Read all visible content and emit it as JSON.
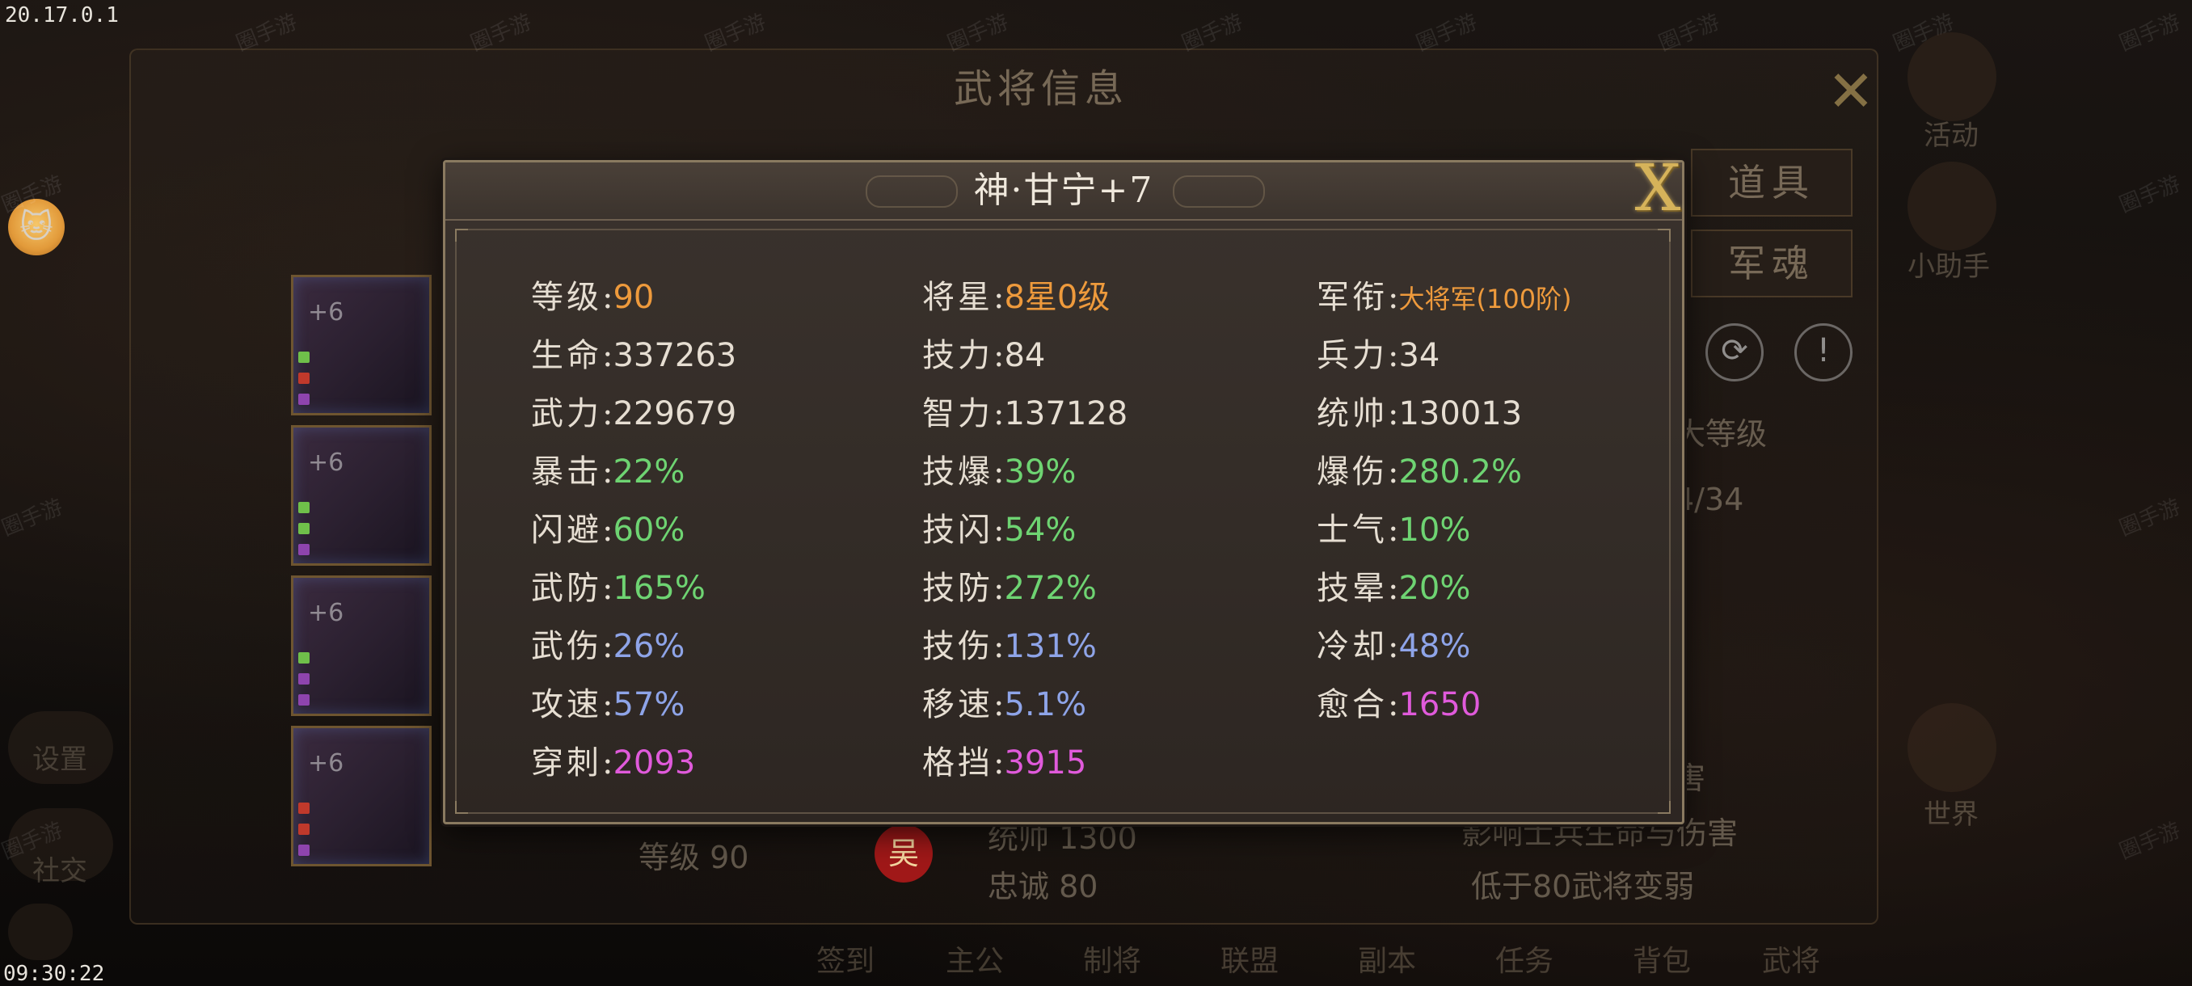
{
  "status": {
    "version": "20.17.0.1",
    "clock": "09:30:22"
  },
  "background_panel": {
    "title": "武将信息",
    "tabs": [
      "道具",
      "军魂"
    ],
    "equipment_levels": [
      "+6",
      "+6",
      "+6",
      "+6"
    ],
    "hero_level_text": "等级 90",
    "faction_badge": "吴",
    "command_text": "统帅 1300",
    "loyalty_text": "忠诚 80",
    "rank_text": "大等级",
    "ratio_text": "4/34",
    "effect_line_1": "害",
    "effect_line_2": "影响士兵生命与伤害",
    "effect_line_3": "低于80武将变弱"
  },
  "left_menu": [
    "设置",
    "社交"
  ],
  "right_menu": [
    "活动",
    "小助手",
    "世界"
  ],
  "bottom_nav": [
    "签到",
    "主公",
    "制将",
    "联盟",
    "副本",
    "任务",
    "背包",
    "武将"
  ],
  "watermark": "圈手游",
  "dialog": {
    "title": "神·甘宁+7",
    "close_label": "X",
    "stats": [
      [
        {
          "label": "等级",
          "value": "90",
          "color": "orange"
        },
        {
          "label": "将星",
          "value": "8星0级",
          "color": "orange"
        },
        {
          "label": "军衔",
          "value": "大将军(100阶)",
          "color": "orange"
        }
      ],
      [
        {
          "label": "生命",
          "value": "337263",
          "color": "white"
        },
        {
          "label": "技力",
          "value": "84",
          "color": "white"
        },
        {
          "label": "兵力",
          "value": "34",
          "color": "white"
        }
      ],
      [
        {
          "label": "武力",
          "value": "229679",
          "color": "white"
        },
        {
          "label": "智力",
          "value": "137128",
          "color": "white"
        },
        {
          "label": "统帅",
          "value": "130013",
          "color": "white"
        }
      ],
      [
        {
          "label": "暴击",
          "value": "22%",
          "color": "green"
        },
        {
          "label": "技爆",
          "value": "39%",
          "color": "green"
        },
        {
          "label": "爆伤",
          "value": "280.2%",
          "color": "green"
        }
      ],
      [
        {
          "label": "闪避",
          "value": "60%",
          "color": "green"
        },
        {
          "label": "技闪",
          "value": "54%",
          "color": "green"
        },
        {
          "label": "士气",
          "value": "10%",
          "color": "green"
        }
      ],
      [
        {
          "label": "武防",
          "value": "165%",
          "color": "green"
        },
        {
          "label": "技防",
          "value": "272%",
          "color": "green"
        },
        {
          "label": "技晕",
          "value": "20%",
          "color": "green"
        }
      ],
      [
        {
          "label": "武伤",
          "value": "26%",
          "color": "blue"
        },
        {
          "label": "技伤",
          "value": "131%",
          "color": "blue"
        },
        {
          "label": "冷却",
          "value": "48%",
          "color": "blue"
        }
      ],
      [
        {
          "label": "攻速",
          "value": "57%",
          "color": "blue"
        },
        {
          "label": "移速",
          "value": "5.1%",
          "color": "blue"
        },
        {
          "label": "愈合",
          "value": "1650",
          "color": "magenta"
        }
      ],
      [
        {
          "label": "穿刺",
          "value": "2093",
          "color": "magenta"
        },
        {
          "label": "格挡",
          "value": "3915",
          "color": "magenta"
        }
      ]
    ]
  },
  "colors": {
    "orange": "#ee9a3c",
    "white": "#e6ded2",
    "green": "#6ed472",
    "blue": "#8ea4e8",
    "magenta": "#e05adb"
  }
}
